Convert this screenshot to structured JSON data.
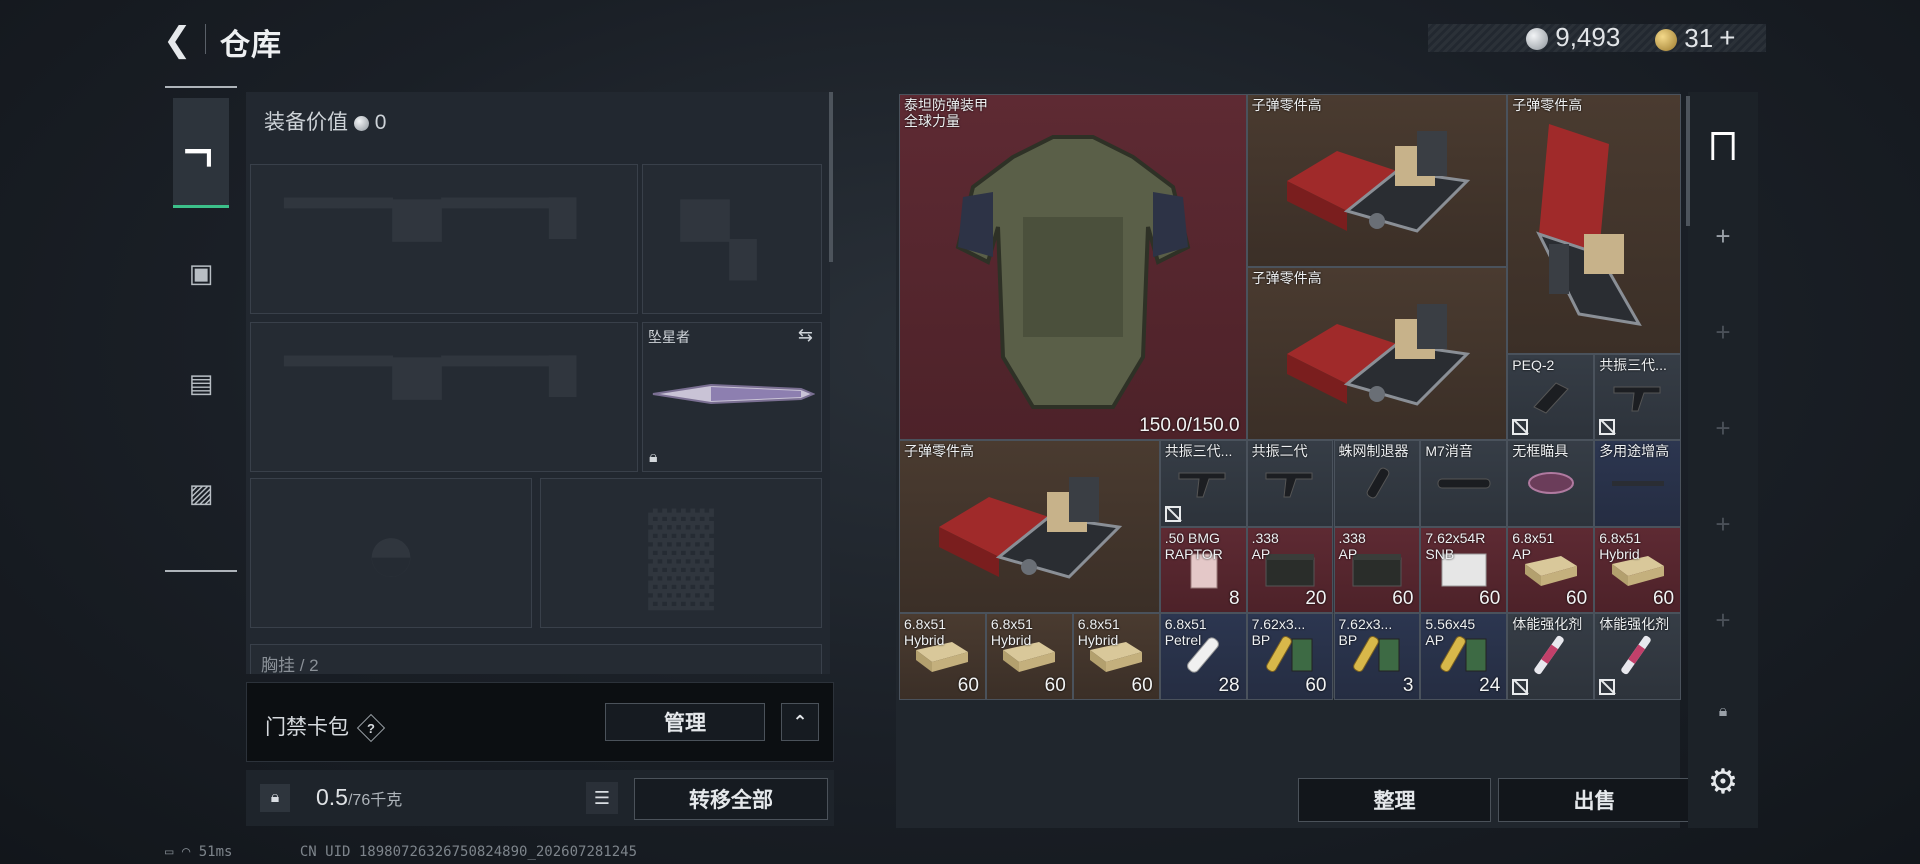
{
  "header": {
    "back_icon": "back-arrow-icon",
    "title": "仓库",
    "silver_amount": "9,493",
    "gold_amount": "31",
    "plus": "+"
  },
  "left_tabs": [
    {
      "icon": "pistol-icon",
      "active": true
    },
    {
      "icon": "backpack-icon"
    },
    {
      "icon": "vest-icon"
    },
    {
      "icon": "briefcase-icon"
    }
  ],
  "equipment": {
    "value_label": "装备价值",
    "value": "0",
    "melee_label": "坠星者",
    "chest_label_partial": "胸挂 / 2"
  },
  "access_card": {
    "label": "门禁卡包",
    "help": "?",
    "manage_button": "管理",
    "collapse_icon": "chevron-up-icon"
  },
  "footer": {
    "weight": "0.5",
    "capacity": "/76千克",
    "transfer_all": "转移全部"
  },
  "status_bar": {
    "ping": "51ms",
    "uid": "CN UID 18980726326750824890_202607281245"
  },
  "inventory": {
    "items": [
      {
        "name": "泰坦防弹装甲\n全球力量",
        "count": "150.0/150.0",
        "bg": "red",
        "c": 0,
        "r": 0,
        "w": 4,
        "h": 4,
        "art": "armor"
      },
      {
        "name": "子弹零件高",
        "count": "",
        "bg": "brown",
        "c": 4,
        "r": 0,
        "w": 3,
        "h": 2,
        "art": "crate"
      },
      {
        "name": "子弹零件高",
        "count": "",
        "bg": "brown",
        "c": 7,
        "r": 0,
        "w": 2,
        "h": 3,
        "art": "crate-v"
      },
      {
        "name": "子弹零件高",
        "count": "",
        "bg": "brown",
        "c": 4,
        "r": 2,
        "w": 3,
        "h": 2,
        "art": "crate"
      },
      {
        "name": "PEQ-2",
        "count": "",
        "bg": "gray",
        "c": 7,
        "r": 3,
        "w": 1,
        "h": 1,
        "art": "peq",
        "broken": true
      },
      {
        "name": "共振三代...",
        "count": "",
        "bg": "gray",
        "c": 8,
        "r": 3,
        "w": 1,
        "h": 1,
        "art": "grip",
        "broken": true
      },
      {
        "name": "子弹零件高",
        "count": "",
        "bg": "brown",
        "c": 0,
        "r": 4,
        "w": 3,
        "h": 2,
        "art": "crate"
      },
      {
        "name": "共振三代...",
        "count": "",
        "bg": "gray",
        "c": 3,
        "r": 4,
        "w": 1,
        "h": 1,
        "art": "grip",
        "broken": true
      },
      {
        "name": "共振二代",
        "count": "",
        "bg": "gray",
        "c": 4,
        "r": 4,
        "w": 1,
        "h": 1,
        "art": "grip"
      },
      {
        "name": "蛛网制退器",
        "count": "",
        "bg": "gray",
        "c": 5,
        "r": 4,
        "w": 1,
        "h": 1,
        "art": "muzzle"
      },
      {
        "name": "M7消音",
        "count": "",
        "bg": "gray",
        "c": 6,
        "r": 4,
        "w": 1,
        "h": 1,
        "art": "silencer"
      },
      {
        "name": "无框瞄具",
        "count": "",
        "bg": "gray",
        "c": 7,
        "r": 4,
        "w": 1,
        "h": 1,
        "art": "sight"
      },
      {
        "name": "多用途增高",
        "count": "",
        "bg": "blue",
        "c": 8,
        "r": 4,
        "w": 1,
        "h": 1,
        "art": "riser"
      },
      {
        "name": ".50 BMG\nRAPTOR",
        "count": "8",
        "bg": "red",
        "c": 3,
        "r": 5,
        "w": 1,
        "h": 1,
        "art": "ammo-box-pink"
      },
      {
        "name": ".338\nAP",
        "count": "20",
        "bg": "red",
        "c": 4,
        "r": 5,
        "w": 1,
        "h": 1,
        "art": "ammo-can"
      },
      {
        "name": ".338\nAP",
        "count": "60",
        "bg": "red",
        "c": 5,
        "r": 5,
        "w": 1,
        "h": 1,
        "art": "ammo-can"
      },
      {
        "name": "7.62x54R\nSNB",
        "count": "60",
        "bg": "red",
        "c": 6,
        "r": 5,
        "w": 1,
        "h": 1,
        "art": "ammo-box-white"
      },
      {
        "name": "6.8x51\nAP",
        "count": "60",
        "bg": "red",
        "c": 7,
        "r": 5,
        "w": 1,
        "h": 1,
        "art": "ammo-box-tan"
      },
      {
        "name": "6.8x51\nHybrid",
        "count": "60",
        "bg": "red",
        "c": 8,
        "r": 5,
        "w": 1,
        "h": 1,
        "art": "ammo-box-tan"
      },
      {
        "name": "6.8x51\nHybrid",
        "count": "60",
        "bg": "brown",
        "c": 0,
        "r": 6,
        "w": 1,
        "h": 1,
        "art": "ammo-box-tan"
      },
      {
        "name": "6.8x51\nHybrid",
        "count": "60",
        "bg": "brown",
        "c": 1,
        "r": 6,
        "w": 1,
        "h": 1,
        "art": "ammo-box-tan"
      },
      {
        "name": "6.8x51\nHybrid",
        "count": "60",
        "bg": "brown",
        "c": 2,
        "r": 6,
        "w": 1,
        "h": 1,
        "art": "ammo-box-tan"
      },
      {
        "name": "6.8x51\nPetrel",
        "count": "28",
        "bg": "blue",
        "c": 3,
        "r": 6,
        "w": 1,
        "h": 1,
        "art": "round-white"
      },
      {
        "name": "7.62x3...\nBP",
        "count": "60",
        "bg": "blue",
        "c": 4,
        "r": 6,
        "w": 1,
        "h": 1,
        "art": "round-green"
      },
      {
        "name": "7.62x3...\nBP",
        "count": "3",
        "bg": "blue",
        "c": 5,
        "r": 6,
        "w": 1,
        "h": 1,
        "art": "round-green"
      },
      {
        "name": "5.56x45\nAP",
        "count": "24",
        "bg": "blue",
        "c": 6,
        "r": 6,
        "w": 1,
        "h": 1,
        "art": "round-green"
      },
      {
        "name": "体能强化剂",
        "count": "",
        "bg": "gray",
        "c": 7,
        "r": 6,
        "w": 1,
        "h": 1,
        "art": "syringe",
        "broken": true
      },
      {
        "name": "体能强化剂",
        "count": "",
        "bg": "gray",
        "c": 8,
        "r": 6,
        "w": 1,
        "h": 1,
        "art": "syringe",
        "broken": true
      }
    ],
    "sort_button": "整理",
    "sell_button": "出售"
  },
  "right_tabs": [
    {
      "icon": "safe-box-icon"
    },
    {
      "icon": "plus-icon"
    },
    {
      "icon": "plus-icon"
    },
    {
      "icon": "plus-icon"
    },
    {
      "icon": "plus-icon"
    },
    {
      "icon": "plus-icon"
    },
    {
      "icon": "lock-icon"
    },
    {
      "icon": "gear-icon"
    }
  ],
  "colors": {
    "accent_green": "#3cc08a",
    "red_item": "#5e2a33",
    "brown_item": "#4a3b30",
    "blue_item": "#2c3650"
  }
}
